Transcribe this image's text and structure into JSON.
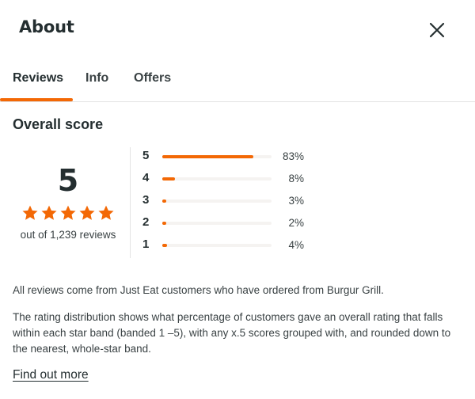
{
  "dialog": {
    "title": "About",
    "close_icon": "close-icon"
  },
  "tabs": [
    {
      "label": "Reviews",
      "active": true
    },
    {
      "label": "Info",
      "active": false
    },
    {
      "label": "Offers",
      "active": false
    }
  ],
  "overall": {
    "section_title": "Overall score",
    "score": "5",
    "stars_filled": 5,
    "stars_total": 5,
    "caption": "out of 1,239 reviews"
  },
  "distribution": [
    {
      "stars": "5",
      "percent_label": "83%",
      "percent": 83
    },
    {
      "stars": "4",
      "percent_label": "8%",
      "percent": 8
    },
    {
      "stars": "3",
      "percent_label": "3%",
      "percent": 3
    },
    {
      "stars": "2",
      "percent_label": "2%",
      "percent": 2
    },
    {
      "stars": "1",
      "percent_label": "4%",
      "percent": 4
    }
  ],
  "info": {
    "paragraph1": "All reviews come from Just Eat customers who have ordered from Burgur Grill.",
    "paragraph2": "The rating distribution shows what percentage of customers gave an overall rating that falls within each star band (banded 1 –5), with any x.5 scores grouped with, and rounded down to the nearest, whole-star band.",
    "link": "Find out more"
  },
  "colors": {
    "accent": "#f36805",
    "text": "#242e30",
    "track": "#f5f3f1"
  }
}
